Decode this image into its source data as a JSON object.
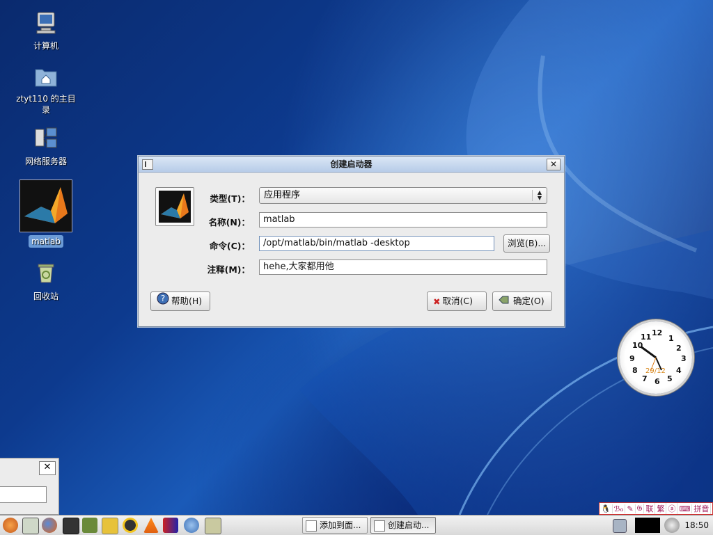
{
  "desktop": {
    "icons": [
      {
        "label": "计算机"
      },
      {
        "label": "ztyt110 的主目录"
      },
      {
        "label": "网络服务器"
      },
      {
        "label": "matlab"
      },
      {
        "label": "回收站"
      }
    ]
  },
  "dialog": {
    "title": "创建启动器",
    "fields": {
      "type_label": "类型(T)：",
      "type_value": "应用程序",
      "name_label": "名称(N)：",
      "name_value": "matlab",
      "command_label": "命令(C)：",
      "command_value": "/opt/matlab/bin/matlab -desktop",
      "browse_label": "浏览(B)...",
      "comment_label": "注释(M)：",
      "comment_value": "hehe,大家都用他"
    },
    "buttons": {
      "help": "帮助(H)",
      "cancel": "取消(C)",
      "ok": "确定(O)"
    }
  },
  "clock": {
    "numbers": [
      "12",
      "1",
      "2",
      "3",
      "4",
      "5",
      "6",
      "7",
      "8",
      "9",
      "10",
      "11"
    ],
    "date": "29/12"
  },
  "tray": {
    "items": [
      "🐧",
      "ℬℴ",
      "✎",
      "𝔊",
      "联",
      "繁",
      "ⓐ",
      "⌨",
      "拼音"
    ]
  },
  "taskbar": {
    "tasks": [
      {
        "label": "添加到面..."
      },
      {
        "label": "创建启动..."
      }
    ],
    "time": "18:50"
  },
  "colors": {
    "accent": "#6b9bd7",
    "titlebar": "#c5d7ef",
    "desktop": "#0d3a8e"
  }
}
